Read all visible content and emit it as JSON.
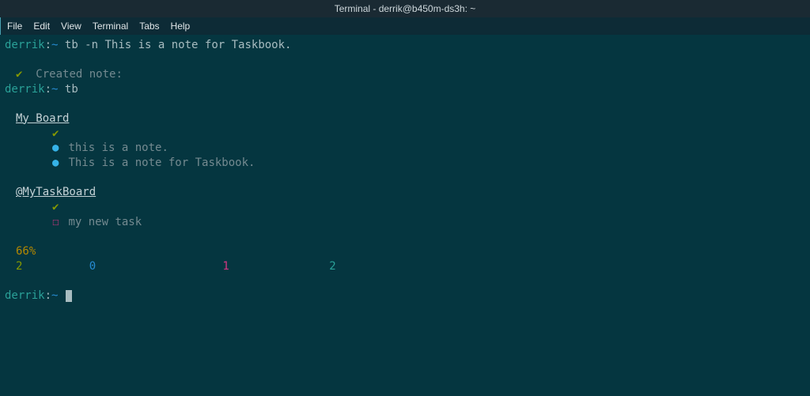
{
  "window": {
    "title": "Terminal - derrik@b450m-ds3h: ~"
  },
  "menu": {
    "file": "File",
    "edit": "Edit",
    "view": "View",
    "terminal": "Terminal",
    "tabs": "Tabs",
    "help": "Help"
  },
  "prompt": {
    "user": "derrik",
    "sep": ":",
    "path": "~",
    "end": " "
  },
  "lines": {
    "cmd1": "tb -n This is a note for Taskbook.",
    "created_note": "Created note:",
    "cmd2": "tb",
    "board1_title": "My Board",
    "board1_note1": "this is a note.",
    "board1_note2": "This is a note for Taskbook.",
    "board2_title": "@MyTaskBoard",
    "board2_task1": "my new task",
    "percent": "66%",
    "stat1": "2",
    "stat2": "0",
    "stat3": "1",
    "stat4": "2"
  },
  "icons": {
    "check": "✔",
    "bullet": "●",
    "box": "☐"
  }
}
